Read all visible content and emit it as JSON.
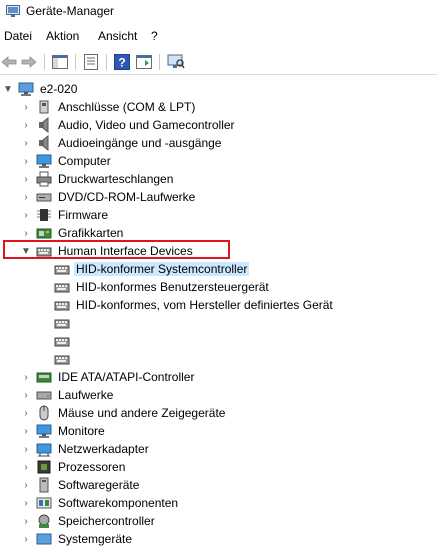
{
  "window": {
    "title": "Geräte-Manager"
  },
  "menu": [
    "Datei",
    "Aktion",
    "Ansicht",
    "?"
  ],
  "toolbar": {
    "buttons": [
      "back-arrow-icon",
      "forward-arrow-icon",
      "show-hide-console-tree-icon",
      "properties-icon",
      "help-icon",
      "action-pane-icon",
      "scan-hardware-icon"
    ]
  },
  "tree": {
    "root": "e2-020",
    "categories": [
      "Anschlüsse (COM & LPT)",
      "Audio, Video und Gamecontroller",
      "Audioeingänge und -ausgänge",
      "Computer",
      "Druckwarteschlangen",
      "DVD/CD-ROM-Laufwerke",
      "Firmware",
      "Grafikkarten"
    ],
    "expanded": "Human Interface Devices",
    "hid_children": [
      "HID-konformer Systemcontroller",
      "HID-konformes Benutzersteuergerät",
      "HID-konformes, vom Hersteller definiertes Gerät",
      "",
      "",
      ""
    ],
    "categories_after": [
      "IDE ATA/ATAPI-Controller",
      "Laufwerke",
      "Mäuse und andere Zeigegeräte",
      "Monitore",
      "Netzwerkadapter",
      "Prozessoren",
      "Softwaregeräte",
      "Softwarekomponenten",
      "Speichercontroller",
      "Systemgeräte"
    ]
  }
}
